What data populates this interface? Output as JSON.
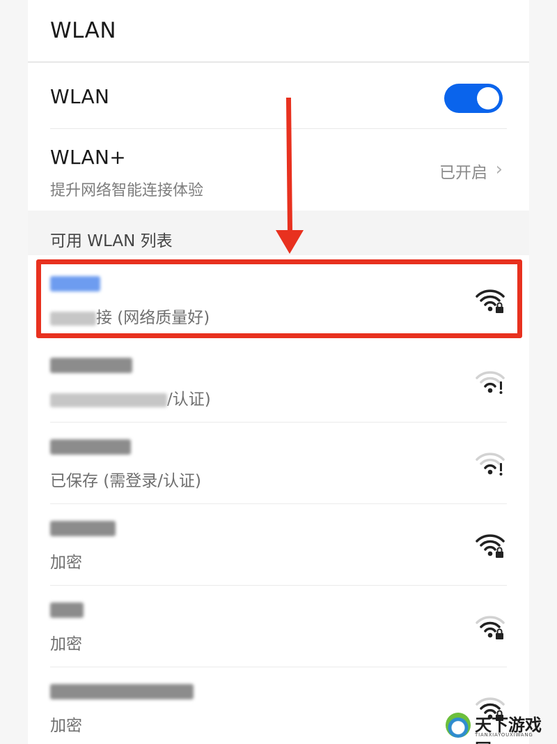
{
  "header": {
    "title": "WLAN"
  },
  "wlan_toggle": {
    "label": "WLAN",
    "enabled": true,
    "accent_color": "#0a64ec"
  },
  "wlan_plus": {
    "label": "WLAN+",
    "description": "提升网络智能连接体验",
    "status": "已开启",
    "chevron": "›"
  },
  "section": {
    "label": "可用 WLAN 列表"
  },
  "networks": [
    {
      "status_suffix": "接 (网络质量好)",
      "icon": "wifi-lock-icon",
      "highlighted": true
    },
    {
      "status_suffix": "/认证)",
      "icon": "wifi-alert-icon"
    },
    {
      "status_suffix": "已保存 (需登录/认证)",
      "icon": "wifi-alert-icon"
    },
    {
      "status_suffix": "加密",
      "icon": "wifi-lock-icon"
    },
    {
      "status_suffix": "加密",
      "icon": "wifi-lock-icon"
    },
    {
      "status_suffix": "加密",
      "icon": "wifi-lock-icon"
    }
  ],
  "annotation": {
    "color": "#e8311f"
  },
  "watermark": {
    "text": "天下游戏网",
    "sub": "TIANXIAYOUXIWANG"
  }
}
